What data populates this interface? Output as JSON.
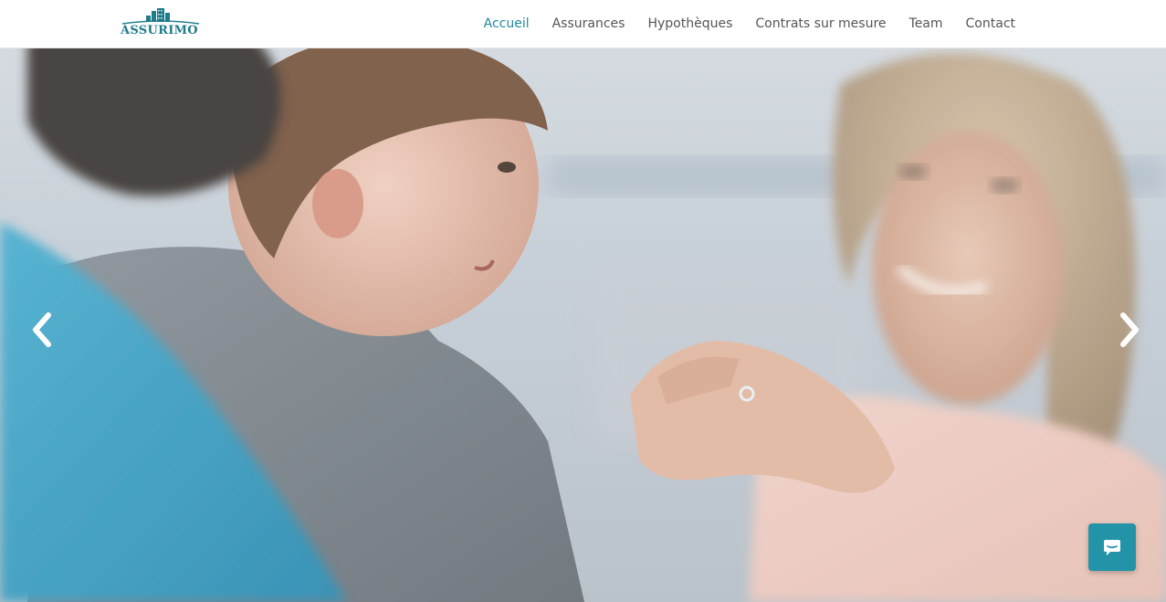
{
  "brand": {
    "name": "ASSURIMO",
    "color": "#1f7c8a"
  },
  "nav": {
    "active_color": "#1f8a9c",
    "items": [
      {
        "label": "Accueil",
        "active": true
      },
      {
        "label": "Assurances",
        "active": false
      },
      {
        "label": "Hypothèques",
        "active": false
      },
      {
        "label": "Contrats sur mesure",
        "active": false
      },
      {
        "label": "Team",
        "active": false
      },
      {
        "label": "Contact",
        "active": false
      }
    ]
  },
  "hero": {
    "prev_icon": "chevron-left-icon",
    "next_icon": "chevron-right-icon"
  },
  "chat": {
    "icon": "chat-bubble-icon",
    "color": "#2394a8"
  }
}
